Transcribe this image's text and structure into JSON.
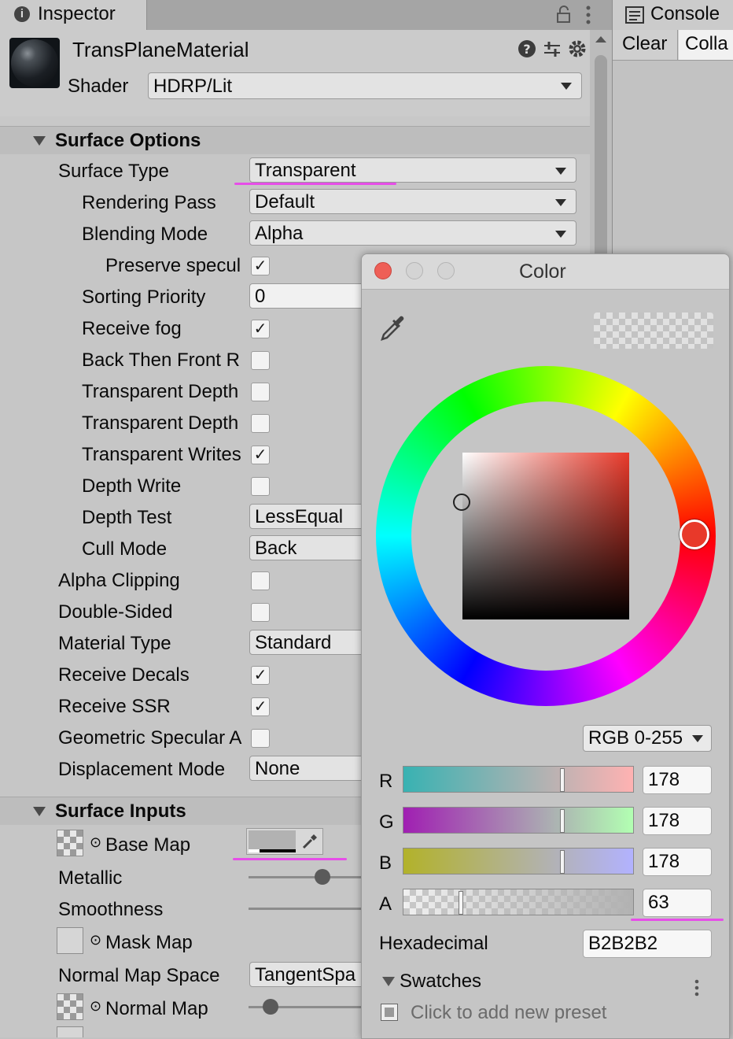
{
  "inspector": {
    "tab_label": "Inspector",
    "material_name": "TransPlaneMaterial",
    "shader_label": "Shader",
    "shader_value": "HDRP/Lit"
  },
  "surface_options": {
    "title": "Surface Options",
    "surface_type": {
      "label": "Surface Type",
      "value": "Transparent"
    },
    "rendering_pass": {
      "label": "Rendering Pass",
      "value": "Default"
    },
    "blending_mode": {
      "label": "Blending Mode",
      "value": "Alpha"
    },
    "preserve_specular": {
      "label": "Preserve specul",
      "checked": true
    },
    "sorting_priority": {
      "label": "Sorting Priority",
      "value": "0"
    },
    "receive_fog": {
      "label": "Receive fog",
      "checked": true
    },
    "back_then_front": {
      "label": "Back Then Front R",
      "checked": false
    },
    "transparent_depth_1": {
      "label": "Transparent Depth",
      "checked": false
    },
    "transparent_depth_2": {
      "label": "Transparent Depth",
      "checked": false
    },
    "transparent_writes": {
      "label": "Transparent Writes",
      "checked": true
    },
    "depth_write": {
      "label": "Depth Write",
      "checked": false
    },
    "depth_test": {
      "label": "Depth Test",
      "value": "LessEqual"
    },
    "cull_mode": {
      "label": "Cull Mode",
      "value": "Back"
    },
    "alpha_clipping": {
      "label": "Alpha Clipping",
      "checked": false
    },
    "double_sided": {
      "label": "Double-Sided",
      "checked": false
    },
    "material_type": {
      "label": "Material Type",
      "value": "Standard"
    },
    "receive_decals": {
      "label": "Receive Decals",
      "checked": true
    },
    "receive_ssr": {
      "label": "Receive SSR",
      "checked": true
    },
    "geometric_specular": {
      "label": "Geometric Specular A",
      "checked": false
    },
    "displacement_mode": {
      "label": "Displacement Mode",
      "value": "None"
    }
  },
  "surface_inputs": {
    "title": "Surface Inputs",
    "base_map": "Base Map",
    "metallic": {
      "label": "Metallic",
      "value": 0.45
    },
    "smoothness": "Smoothness",
    "mask_map": "Mask Map",
    "normal_map_space": {
      "label": "Normal Map Space",
      "value": "TangentSpa"
    },
    "normal_map": {
      "label": "Normal Map",
      "value": 0.15
    }
  },
  "console": {
    "tab_label": "Console",
    "clear_label": "Clear",
    "collapse_label": "Colla"
  },
  "color_picker": {
    "title": "Color",
    "mode": "RGB 0-255",
    "channels": [
      {
        "label": "R",
        "value": "178"
      },
      {
        "label": "G",
        "value": "178"
      },
      {
        "label": "B",
        "value": "178"
      },
      {
        "label": "A",
        "value": "63"
      }
    ],
    "hex_label": "Hexadecimal",
    "hex_value": "B2B2B2",
    "swatches_label": "Swatches",
    "add_preset_text": "Click to add new preset",
    "colors": {
      "hue": "#e8392a",
      "close": "#ee5f57",
      "accent_underline": "#e64ee8"
    }
  }
}
